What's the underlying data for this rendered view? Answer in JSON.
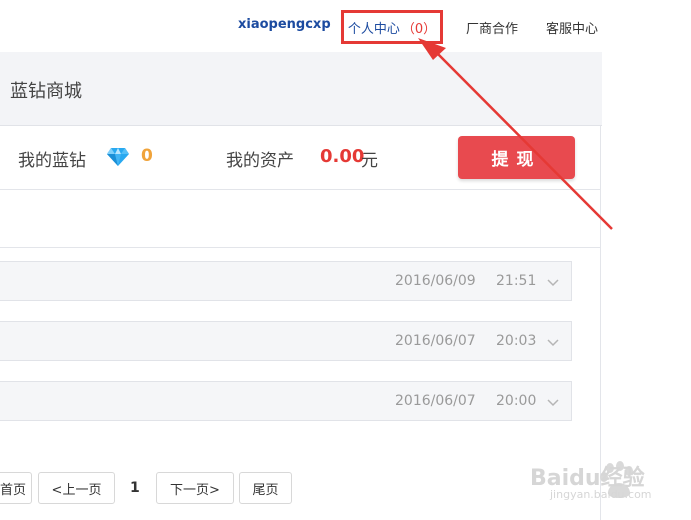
{
  "topnav": {
    "username": "xiaopengcxp",
    "personal_center_label": "个人中心",
    "personal_center_count": "（0）",
    "vendor_label": "厂商合作",
    "service_label": "客服中心"
  },
  "mall": {
    "title": "蓝钻商城"
  },
  "assets": {
    "diamond_label": "我的蓝钻",
    "diamond_count": "0",
    "asset_label": "我的资产",
    "asset_value": "0.00",
    "asset_unit": "元",
    "withdraw_label": "提现"
  },
  "records": [
    {
      "date": "2016/06/09",
      "time": "21:51"
    },
    {
      "date": "2016/06/07",
      "time": "20:03"
    },
    {
      "date": "2016/06/07",
      "time": "20:00"
    }
  ],
  "pagination": {
    "first": "首页",
    "prev": "<上一页",
    "current": "1",
    "next": "下一页>",
    "last": "尾页"
  },
  "watermark": {
    "brand": "Baidu经验",
    "url": "jingyan.baidu.com"
  },
  "colors": {
    "accent_red": "#e84a4f",
    "link_blue": "#1c4ba0",
    "diamond_orange": "#f0a33a",
    "annotation_red": "#e53935"
  },
  "icons": [
    "diamond-icon",
    "chevron-down-icon"
  ]
}
